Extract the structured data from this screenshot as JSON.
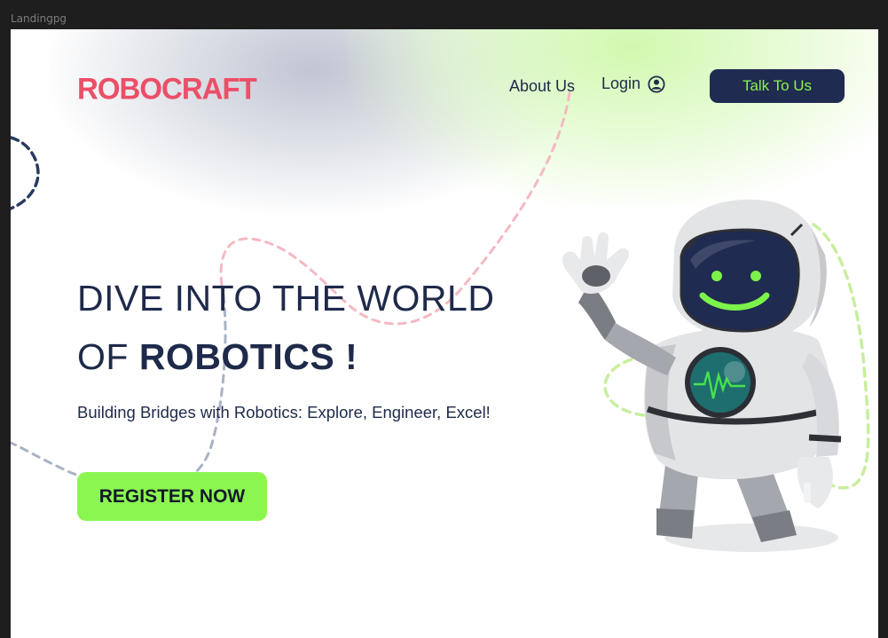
{
  "frame": {
    "label": "Landingpg"
  },
  "header": {
    "logo_text": "ROBOCRAFT",
    "nav": {
      "about_label": "About Us",
      "login_label": "Login",
      "login_icon": "user-circle-icon"
    },
    "cta_label": "Talk To Us"
  },
  "hero": {
    "headline_line1": "DIVE INTO THE WORLD",
    "headline_line2_prefix": "OF ",
    "headline_line2_strong": "ROBOTICS !",
    "subheadline": "Building Bridges with Robotics: Explore, Engineer, Excel!",
    "register_label": "REGISTER NOW",
    "illustration": "waving-robot-astronaut"
  },
  "colors": {
    "brand_red": "#ec4f68",
    "navy": "#1f2b50",
    "accent_green": "#8cf651",
    "cta_text_green": "#8df34b",
    "canvas_bg": "#ffffff",
    "frame_bg": "#1e1e1e"
  }
}
